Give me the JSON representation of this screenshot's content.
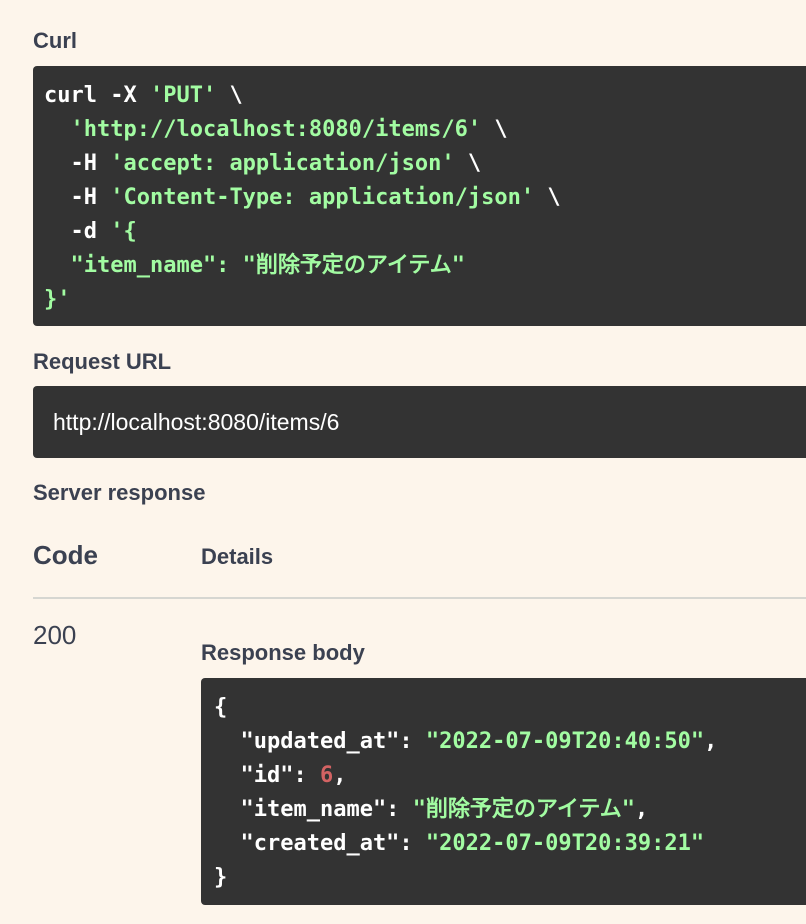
{
  "curl": {
    "heading": "Curl",
    "lines": [
      [
        {
          "t": "curl -X ",
          "c": "white"
        },
        {
          "t": "'PUT'",
          "c": "str"
        },
        {
          "t": " \\",
          "c": "white"
        }
      ],
      [
        {
          "t": "  ",
          "c": "white"
        },
        {
          "t": "'http://localhost:8080/items/6'",
          "c": "str"
        },
        {
          "t": " \\",
          "c": "white"
        }
      ],
      [
        {
          "t": "  -H ",
          "c": "white"
        },
        {
          "t": "'accept: application/json'",
          "c": "str"
        },
        {
          "t": " \\",
          "c": "white"
        }
      ],
      [
        {
          "t": "  -H ",
          "c": "white"
        },
        {
          "t": "'Content-Type: application/json'",
          "c": "str"
        },
        {
          "t": " \\",
          "c": "white"
        }
      ],
      [
        {
          "t": "  -d ",
          "c": "white"
        },
        {
          "t": "'{",
          "c": "str"
        }
      ],
      [
        {
          "t": "  \"item_name\": \"削除予定のアイテム\"",
          "c": "str"
        }
      ],
      [
        {
          "t": "}'",
          "c": "str"
        }
      ]
    ]
  },
  "request_url": {
    "heading": "Request URL",
    "value": "http://localhost:8080/items/6"
  },
  "server_response": {
    "heading": "Server response",
    "col_code": "Code",
    "col_details": "Details",
    "status_code": "200",
    "body_heading": "Response body",
    "body_lines": [
      [
        {
          "t": "{",
          "c": "white"
        }
      ],
      [
        {
          "t": "  \"updated_at\": ",
          "c": "white"
        },
        {
          "t": "\"2022-07-09T20:40:50\"",
          "c": "str"
        },
        {
          "t": ",",
          "c": "white"
        }
      ],
      [
        {
          "t": "  \"id\": ",
          "c": "white"
        },
        {
          "t": "6",
          "c": "num"
        },
        {
          "t": ",",
          "c": "white"
        }
      ],
      [
        {
          "t": "  \"item_name\": ",
          "c": "white"
        },
        {
          "t": "\"削除予定のアイテム\"",
          "c": "str"
        },
        {
          "t": ",",
          "c": "white"
        }
      ],
      [
        {
          "t": "  \"created_at\": ",
          "c": "white"
        },
        {
          "t": "\"2022-07-09T20:39:21\"",
          "c": "str"
        }
      ],
      [
        {
          "t": "}",
          "c": "white"
        }
      ]
    ]
  },
  "colors": {
    "background": "#fdf5eb",
    "code_background": "#333333",
    "string": "#a2fca2",
    "number": "#d36363",
    "heading_text": "#3b4151"
  }
}
